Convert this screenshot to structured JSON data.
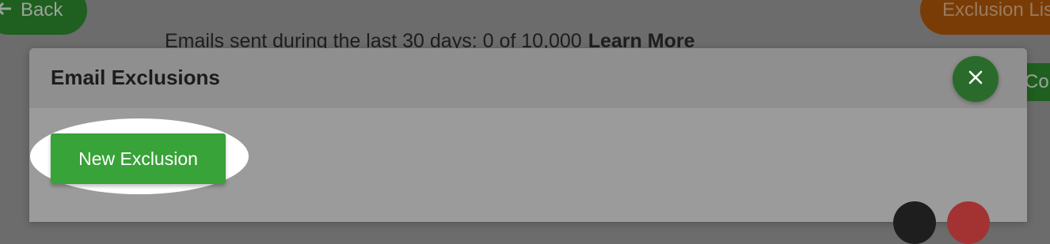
{
  "background": {
    "back_label": "Back",
    "exclusion_list_label": "Exclusion List",
    "stats_text": "Emails sent during the last 30 days: 0 of 10,000",
    "learn_more_label": "Learn More",
    "right_button_label": "Contacts"
  },
  "modal": {
    "title": "Email Exclusions",
    "new_exclusion_label": "New Exclusion"
  },
  "colors": {
    "primary_green": "#38a338",
    "close_green": "#2a6a2a",
    "orange": "#7a3c06",
    "danger_red": "#a33333"
  },
  "icons": {
    "back": "arrow-left-icon",
    "close": "close-icon"
  }
}
